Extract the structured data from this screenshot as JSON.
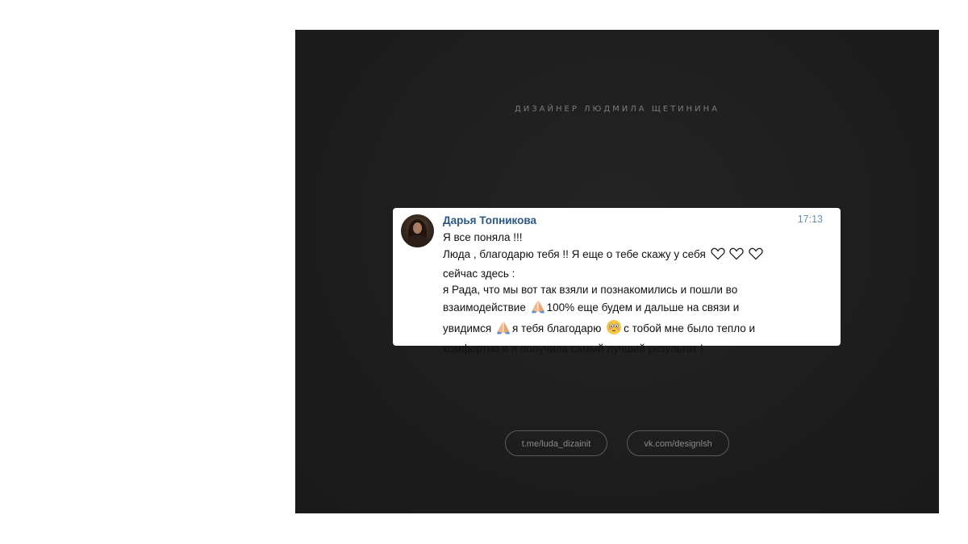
{
  "slide": {
    "designer_title": "ДИЗАЙНЕР ЛЮДМИЛА ЩЕТИНИНА"
  },
  "message": {
    "sender_name": "Дарья Топникова",
    "time": "17:13",
    "lines": [
      "Я все поняла !!!",
      "Люда , благодарю тебя !! Я еще о тебе скажу у себя",
      "сейчас здесь :",
      "я Рада, что мы вот так взяли и познакомились и пошли во",
      "взаимодействие",
      "100% еще будем и дальше на связи и",
      "увидимся",
      "я тебя благодарю",
      "с тобой мне было тепло и",
      "комфортно и я получила самый лучший результат !"
    ],
    "icons": {
      "heart": "heart-outline-icon",
      "pray": "folded-hands-emoji-icon",
      "face": "flushed-face-emoji-icon"
    }
  },
  "links": {
    "telegram": "t.me/luda_dizainit",
    "vk": "vk.com/designlsh"
  }
}
